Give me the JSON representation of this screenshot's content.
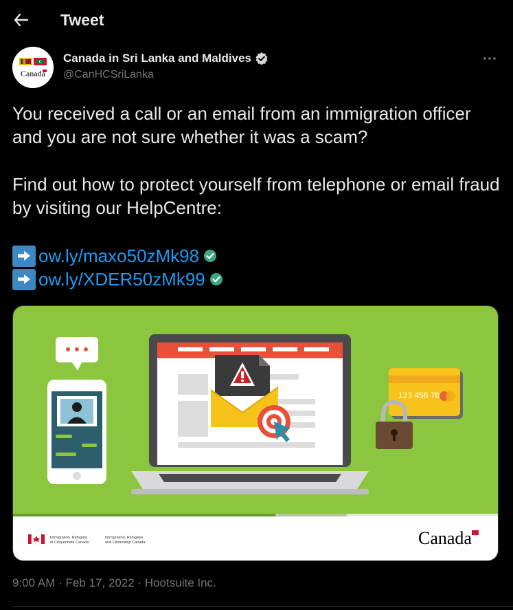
{
  "header": {
    "title": "Tweet",
    "back_icon": "arrow-left-icon"
  },
  "author": {
    "name": "Canada in Sri Lanka and Maldives",
    "handle": "@CanHCSriLanka",
    "verified": true,
    "avatar_wordmark": "Canada"
  },
  "tweet": {
    "paragraph1": "You received a call or an email from an immigration officer and you are not sure whether it was a scam?",
    "paragraph2": "Find out how to protect yourself from telephone or email fraud by visiting our HelpCentre:",
    "links": [
      {
        "text": "ow.ly/maxo50zMk98"
      },
      {
        "text": "ow.ly/XDER50zMk99"
      }
    ]
  },
  "media": {
    "card_number": "123 456 78",
    "footer_fr": "Immigration, Réfugiés et Citoyenneté Canada",
    "footer_en": "Immigration, Refugees and Citizenship Canada",
    "wordmark": "Canada"
  },
  "meta": {
    "time": "9:00 AM",
    "date": "Feb 17, 2022",
    "source": "Hootsuite Inc."
  },
  "colors": {
    "background": "#000000",
    "text": "#e7e9ea",
    "secondary": "#71767b",
    "link": "#1d9bf0",
    "illustration_bg": "#8cc63f"
  }
}
